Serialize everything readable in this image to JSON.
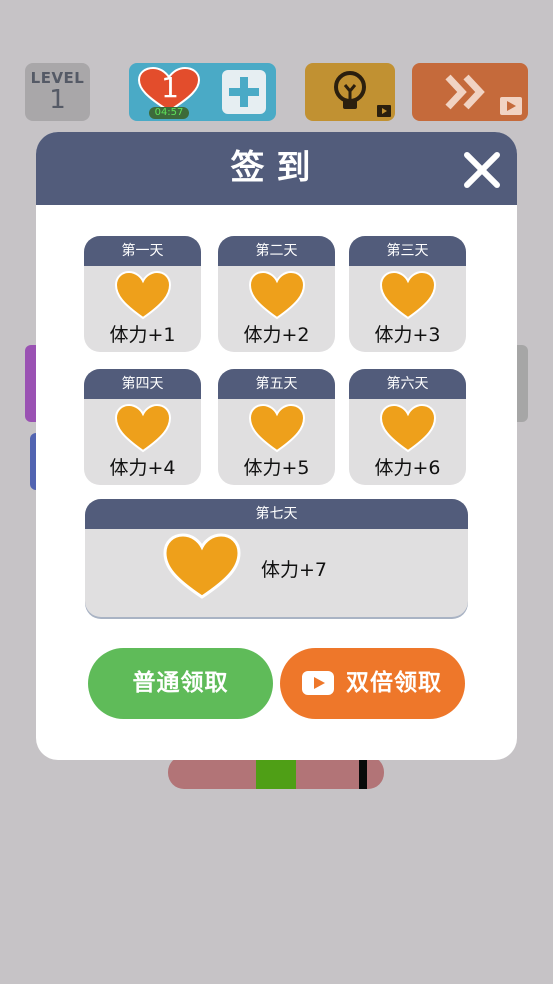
{
  "hud": {
    "level_label": "LEVEL",
    "level_value": "1",
    "lives_value": "1",
    "lives_timer": "04:57",
    "icons": [
      "heart-icon",
      "plus-icon",
      "lightbulb-icon",
      "video-ad-icon",
      "fast-forward-icon"
    ],
    "colors": {
      "level_bg": "#a9a7a9",
      "lives_bg": "#4aaac6",
      "hint_bg": "#c19132",
      "skip_bg": "#c56a3b"
    }
  },
  "progress_bar": {
    "colors": {
      "track": "#b27477",
      "target": "#4f9f16",
      "marker": "#0a0a0a"
    }
  },
  "dialog": {
    "title": "签到",
    "close_icon": "close-icon",
    "days": [
      {
        "label": "第一天",
        "reward": "体力+1"
      },
      {
        "label": "第二天",
        "reward": "体力+2"
      },
      {
        "label": "第三天",
        "reward": "体力+3"
      },
      {
        "label": "第四天",
        "reward": "体力+4"
      },
      {
        "label": "第五天",
        "reward": "体力+5"
      },
      {
        "label": "第六天",
        "reward": "体力+6"
      },
      {
        "label": "第七天",
        "reward": "体力+7"
      }
    ],
    "buttons": {
      "normal_claim": "普通领取",
      "double_claim": "双倍领取"
    },
    "colors": {
      "header": "#525c7b",
      "card": "#e0dfe0",
      "heart": "#eea01b",
      "normal_button": "#5fbb59",
      "double_button": "#ee772a"
    }
  }
}
